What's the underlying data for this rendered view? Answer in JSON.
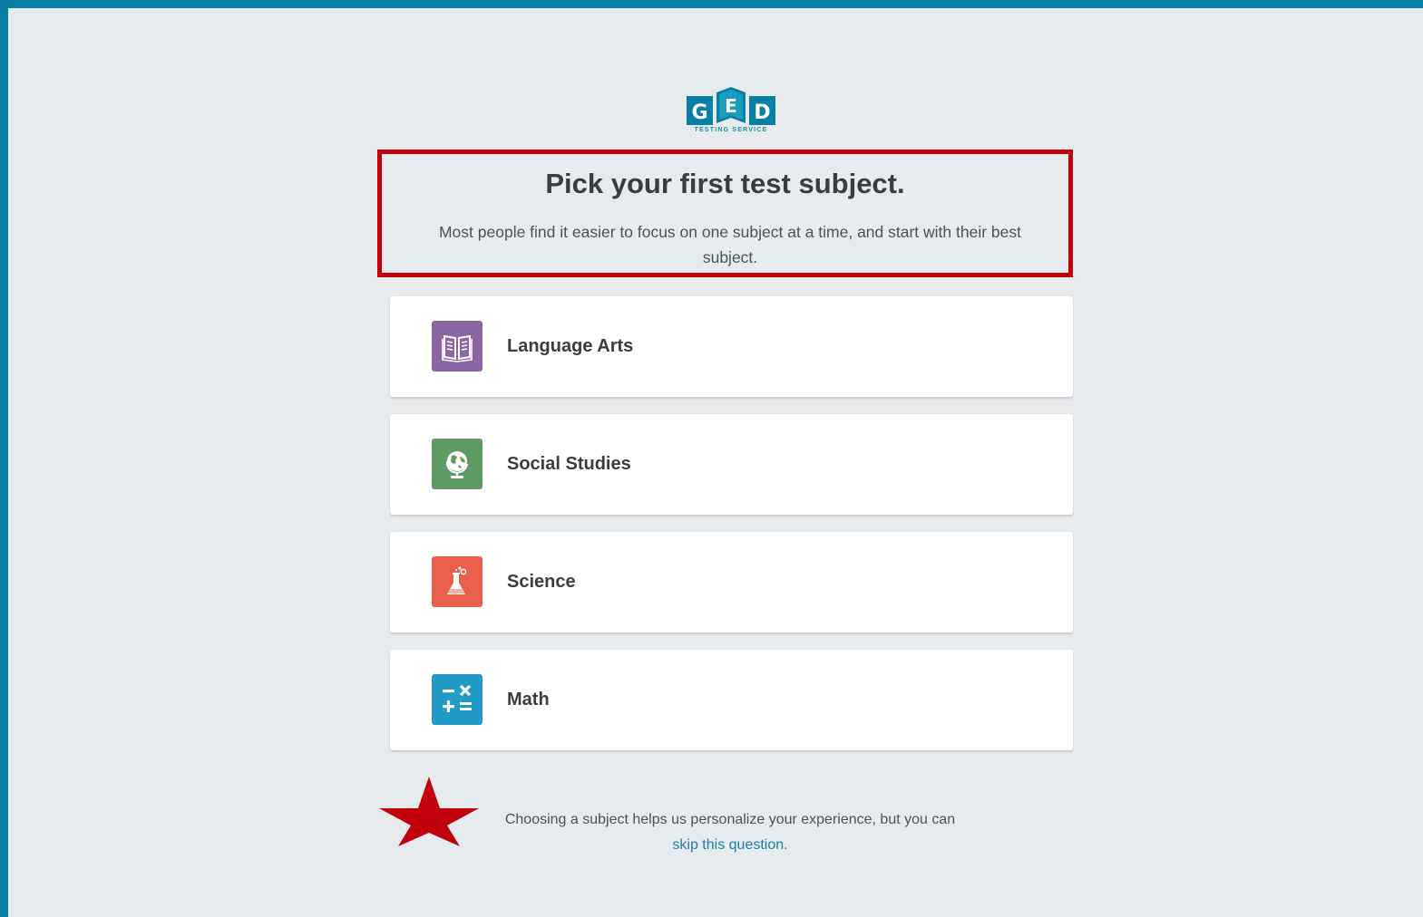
{
  "brand": {
    "logo_letters": [
      "G",
      "E",
      "D"
    ],
    "logo_subtitle": "TESTING SERVICE",
    "logo_color": "#0a7fa6"
  },
  "header": {
    "title": "Pick your first test subject.",
    "subtitle": "Most people find it easier to focus on one subject at a time, and start with their best subject."
  },
  "subjects": [
    {
      "label": "Language Arts",
      "icon": "book-icon",
      "color": "#8a66a2"
    },
    {
      "label": "Social Studies",
      "icon": "globe-icon",
      "color": "#5d9a64"
    },
    {
      "label": "Science",
      "icon": "flask-icon",
      "color": "#e8604c"
    },
    {
      "label": "Math",
      "icon": "math-symbols-icon",
      "color": "#239bc7"
    }
  ],
  "footer": {
    "text": "Choosing a subject helps us personalize your experience, but you can",
    "link_text": "skip this question."
  },
  "annotations": {
    "highlight_color": "#c0000b",
    "star_color": "#c0000b"
  }
}
